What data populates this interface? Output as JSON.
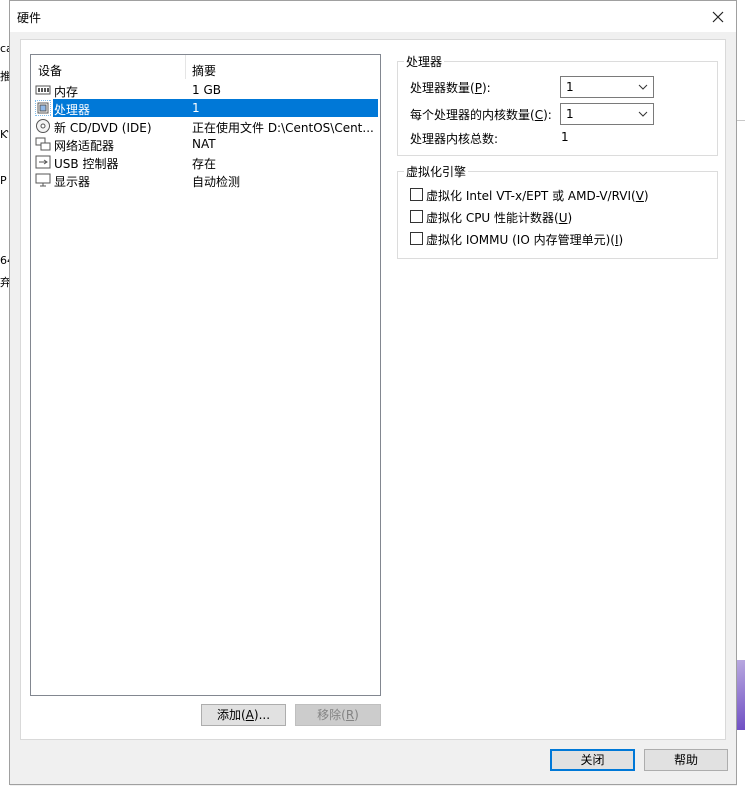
{
  "window": {
    "title": "硬件"
  },
  "background": {
    "fragments": [
      "ca",
      "推",
      "Ƙ",
      "64",
      "弃",
      "P"
    ]
  },
  "device_list": {
    "headers": {
      "device": "设备",
      "summary": "摘要"
    },
    "rows": [
      {
        "name": "内存",
        "summary": "1 GB",
        "icon": "memory-icon"
      },
      {
        "name": "处理器",
        "summary": "1",
        "icon": "processor-icon",
        "selected": true
      },
      {
        "name": "新 CD/DVD (IDE)",
        "summary": "正在使用文件 D:\\CentOS\\Cent...",
        "icon": "cd-dvd-icon"
      },
      {
        "name": "网络适配器",
        "summary": "NAT",
        "icon": "network-adapter-icon"
      },
      {
        "name": "USB 控制器",
        "summary": "存在",
        "icon": "usb-icon"
      },
      {
        "name": "显示器",
        "summary": "自动检测",
        "icon": "monitor-icon"
      }
    ]
  },
  "buttons": {
    "add_prefix": "添加(",
    "add_key": "A",
    "add_suffix": ")...",
    "remove_prefix": "移除(",
    "remove_key": "R",
    "remove_suffix": ")",
    "close": "关闭",
    "help": "帮助"
  },
  "processor": {
    "group_title": "处理器",
    "count_label_prefix": "处理器数量(",
    "count_label_key": "P",
    "count_label_suffix": "):",
    "count_value": "1",
    "cores_label_prefix": "每个处理器的内核数量(",
    "cores_label_key": "C",
    "cores_label_suffix": "):",
    "cores_value": "1",
    "total_label": "处理器内核总数:",
    "total_value": "1"
  },
  "virtualization": {
    "group_title": "虚拟化引擎",
    "options": [
      {
        "prefix": "虚拟化 Intel VT-x/EPT 或 AMD-V/RVI(",
        "key": "V",
        "suffix": ")",
        "checked": false
      },
      {
        "prefix": "虚拟化 CPU 性能计数器(",
        "key": "U",
        "suffix": ")",
        "checked": false
      },
      {
        "prefix": "虚拟化 IOMMU (IO 内存管理单元)(",
        "key": "I",
        "suffix": ")",
        "checked": false
      }
    ]
  }
}
